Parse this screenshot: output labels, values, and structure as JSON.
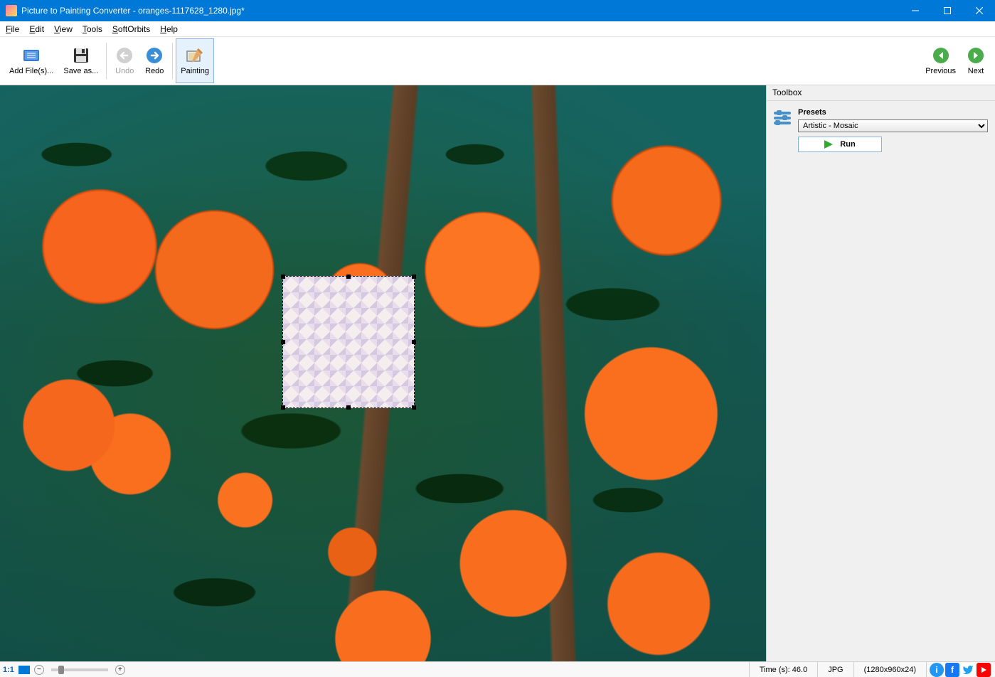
{
  "titlebar": {
    "title": "Picture to Painting Converter - oranges-1117628_1280.jpg*"
  },
  "menubar": {
    "items": [
      "File",
      "Edit",
      "View",
      "Tools",
      "SoftOrbits",
      "Help"
    ]
  },
  "toolbar": {
    "add_files": "Add File(s)...",
    "save_as": "Save as...",
    "undo": "Undo",
    "redo": "Redo",
    "painting": "Painting",
    "previous": "Previous",
    "next": "Next"
  },
  "sidepanel": {
    "title": "Toolbox",
    "presets_label": "Presets",
    "preset_value": "Artistic - Mosaic",
    "run_label": "Run"
  },
  "statusbar": {
    "zoom_label": "1:1",
    "time_label": "Time (s): 46.0",
    "format": "JPG",
    "dimensions": "(1280x960x24)"
  }
}
